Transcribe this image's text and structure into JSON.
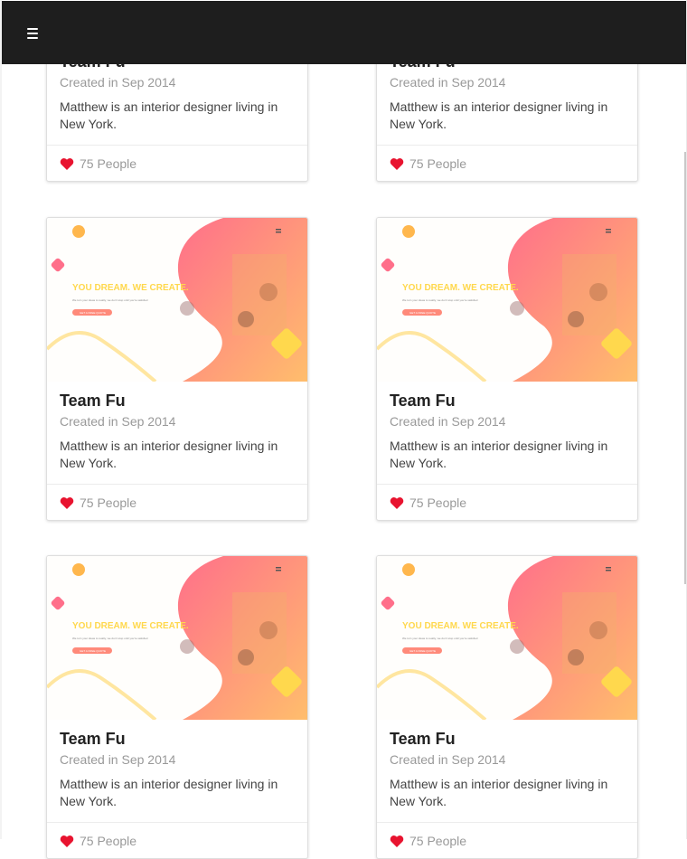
{
  "navbar": {
    "menu_icon": "hamburger-menu-icon"
  },
  "card_image": {
    "headline": "YOU DREAM. WE CREATE.",
    "tagline": "We turn your ideas to reality, we don't stop until you're satisfied",
    "cta": "GET A FREE QUOTE",
    "logo_icon": "team-logo-icon",
    "menu_icon": "mini-menu-icon"
  },
  "cards": [
    {
      "title": "Team Fu",
      "subtitle": "Created in Sep 2014",
      "description": "Matthew is an interior designer living in New York.",
      "likes": "75 People"
    },
    {
      "title": "Team Fu",
      "subtitle": "Created in Sep 2014",
      "description": "Matthew is an interior designer living in New York.",
      "likes": "75 People"
    },
    {
      "title": "Team Fu",
      "subtitle": "Created in Sep 2014",
      "description": "Matthew is an interior designer living in New York.",
      "likes": "75 People"
    },
    {
      "title": "Team Fu",
      "subtitle": "Created in Sep 2014",
      "description": "Matthew is an interior designer living in New York.",
      "likes": "75 People"
    },
    {
      "title": "Team Fu",
      "subtitle": "Created in Sep 2014",
      "description": "Matthew is an interior designer living in New York.",
      "likes": "75 People"
    },
    {
      "title": "Team Fu",
      "subtitle": "Created in Sep 2014",
      "description": "Matthew is an interior designer living in New York.",
      "likes": "75 People"
    }
  ],
  "colors": {
    "navbar": "#1e1e1e",
    "heart": "#e8132f",
    "accent_yellow": "#ffd84d",
    "gradient_start": "#ff6f8a",
    "gradient_end": "#ffbe6c"
  }
}
